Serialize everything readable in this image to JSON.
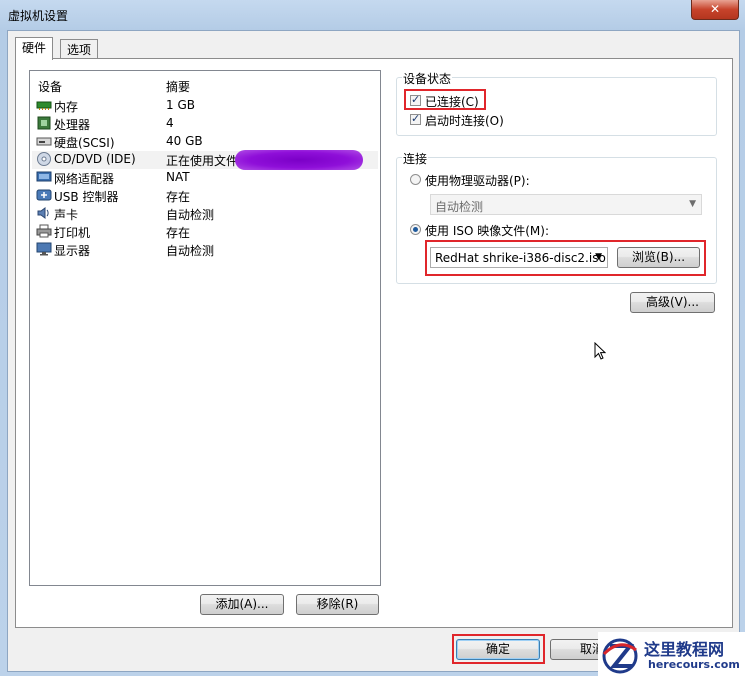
{
  "window": {
    "title": "虚拟机设置",
    "close_label": "✕"
  },
  "tabs": [
    {
      "label": "硬件"
    },
    {
      "label": "选项"
    }
  ],
  "device_list": {
    "headers": {
      "device": "设备",
      "summary": "摘要"
    },
    "rows": [
      {
        "name": "内存",
        "summary": "1 GB",
        "icon": "memory-icon"
      },
      {
        "name": "处理器",
        "summary": "4",
        "icon": "processor-icon"
      },
      {
        "name": "硬盘(SCSI)",
        "summary": "40 GB",
        "icon": "hard-disk-icon"
      },
      {
        "name": "CD/DVD (IDE)",
        "summary": "正在使用文件",
        "icon": "cd-dvd-icon"
      },
      {
        "name": "网络适配器",
        "summary": "NAT",
        "icon": "network-adapter-icon"
      },
      {
        "name": "USB 控制器",
        "summary": "存在",
        "icon": "usb-icon"
      },
      {
        "name": "声卡",
        "summary": "自动检测",
        "icon": "sound-card-icon"
      },
      {
        "name": "打印机",
        "summary": "存在",
        "icon": "printer-icon"
      },
      {
        "name": "显示器",
        "summary": "自动检测",
        "icon": "display-icon"
      }
    ]
  },
  "buttons": {
    "add": "添加(A)...",
    "remove": "移除(R)",
    "browse": "浏览(B)...",
    "advanced": "高级(V)...",
    "ok": "确定",
    "cancel": "取消"
  },
  "device_status": {
    "title": "设备状态",
    "connected": "已连接(C)",
    "connect_at_power_on": "启动时连接(O)"
  },
  "connection": {
    "title": "连接",
    "use_physical_drive": "使用物理驱动器(P):",
    "physical_drive_value": "自动检测",
    "use_iso": "使用 ISO 映像文件(M):",
    "iso_value": "RedHat shrike-i386-disc2.iso"
  },
  "watermark": {
    "title": "这里教程网",
    "url": "herecours.com"
  },
  "colors": {
    "highlight_box": "#e0262b",
    "redaction": "#8f0fd9"
  }
}
